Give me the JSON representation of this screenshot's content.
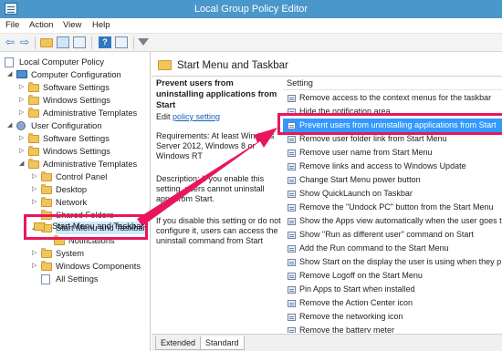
{
  "window": {
    "title": "Local Group Policy Editor"
  },
  "menubar": [
    "File",
    "Action",
    "View",
    "Help"
  ],
  "tree": {
    "items": [
      {
        "label": "Local Computer Policy"
      },
      {
        "label": "Computer Configuration"
      },
      {
        "label": "Software Settings"
      },
      {
        "label": "Windows Settings"
      },
      {
        "label": "Administrative Templates"
      },
      {
        "label": "User Configuration"
      },
      {
        "label": "Software Settings"
      },
      {
        "label": "Windows Settings"
      },
      {
        "label": "Administrative Templates"
      },
      {
        "label": "Control Panel"
      },
      {
        "label": "Desktop"
      },
      {
        "label": "Network"
      },
      {
        "label": "Shared Folders"
      },
      {
        "label": "Start Menu and Taskbar"
      },
      {
        "label": "Notifications"
      },
      {
        "label": "System"
      },
      {
        "label": "Windows Components"
      },
      {
        "label": "All Settings"
      }
    ],
    "highlighted_label": "Start Menu and Taskbar"
  },
  "content": {
    "header_title": "Start Menu and Taskbar",
    "policy_title": "Prevent users from uninstalling applications from Start",
    "edit_prefix": "Edit",
    "edit_link": "policy setting",
    "requirements": "Requirements: At least Windows Server 2012, Windows 8 or Windows RT",
    "description": "Description: If you enable this setting, users cannot uninstall apps from Start.",
    "description2": "If you disable this setting or do not configure it, users can access the uninstall command from Start",
    "column_header": "Setting",
    "settings": [
      "Remove access to the context menus for the taskbar",
      "Hide the notification area",
      "Prevent users from uninstalling applications from Start",
      "Remove user folder link from Start Menu",
      "Remove user name from Start Menu",
      "Remove links and access to Windows Update",
      "Change Start Menu power button",
      "Show QuickLaunch on Taskbar",
      "Remove the \"Undock PC\" button from the Start Menu",
      "Show the Apps view automatically when the user goes t",
      "Show \"Run as different user\" command on Start",
      "Add the Run command to the Start Menu",
      "Show Start on the display the user is using when they p",
      "Remove Logoff on the Start Menu",
      "Pin Apps to Start when installed",
      "Remove the Action Center icon",
      "Remove the networking icon",
      "Remove the battery meter"
    ],
    "selected_index": 2
  },
  "tabs": [
    "Extended",
    "Standard"
  ],
  "colors": {
    "titlebar": "#4a97cc",
    "highlight": "#e8175d",
    "selection": "#3399ff"
  }
}
